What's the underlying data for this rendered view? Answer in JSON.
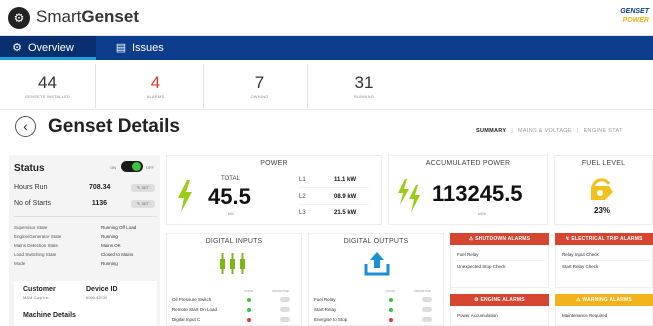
{
  "header": {
    "app_name_light": "Smart",
    "app_name_bold": "Genset",
    "brand_line1": "GENSET",
    "brand_line2": "POWER"
  },
  "nav": {
    "tabs": [
      {
        "label": "Overview",
        "icon": "gear-icon"
      },
      {
        "label": "Issues",
        "icon": "table-icon"
      }
    ]
  },
  "stats": [
    {
      "value": "44",
      "label": "GENSETS INSTALLED"
    },
    {
      "value": "4",
      "label": "ALARMS",
      "color": "#e03a2e"
    },
    {
      "value": "7",
      "label": "OWNING"
    },
    {
      "value": "31",
      "label": "RUNNING"
    }
  ],
  "page": {
    "title": "Genset Details",
    "back_icon": "back-arrow-icon",
    "sub_tabs": [
      "SUMMARY",
      "MAINS & VOLTAGE",
      "ENGINE STAT"
    ]
  },
  "status": {
    "title": "Status",
    "toggle_on": "ON",
    "toggle_off": "OFF",
    "hours_label": "Hours Run",
    "hours_value": "708.34",
    "starts_label": "No of Starts",
    "starts_value": "1136",
    "edit_label": "SET",
    "states": [
      {
        "label": "Supervisor State",
        "value": "Running Off Load"
      },
      {
        "label": "Engine/Generator State",
        "value": "Running"
      },
      {
        "label": "Mains Detection State",
        "value": "Mains OK"
      },
      {
        "label": "Load Switching State",
        "value": "Closed to Mains"
      },
      {
        "label": "Mode",
        "value": "Running"
      }
    ],
    "customer_label": "Customer",
    "customer_value": "M&M Corp Inc.",
    "device_label": "Device ID",
    "device_value": "6099-4DCB",
    "machine_label": "Machine Details"
  },
  "power": {
    "title": "POWER",
    "total_label": "TOTAL",
    "total_value": "45.5",
    "unit": "kW",
    "phases": [
      {
        "label": "L1",
        "value": "11.1 kW"
      },
      {
        "label": "L2",
        "value": "08.9 kW"
      },
      {
        "label": "L3",
        "value": "21.5 kW"
      }
    ]
  },
  "accumulated": {
    "title": "ACCUMULATED POWER",
    "value": "113245.5",
    "unit": "kWh"
  },
  "fuel": {
    "title": "FUEL LEVEL",
    "value": "23%"
  },
  "digital_inputs": {
    "title": "DIGITAL INPUTS",
    "col1": "STATE",
    "col2": "PRIORITISE",
    "rows": [
      {
        "label": "Oil Pressure Switch",
        "dot": "#3ec23e"
      },
      {
        "label": "Remote Start On Load",
        "dot": "#3ec23e"
      },
      {
        "label": "Digital Input C",
        "dot": "#e03a2e"
      }
    ]
  },
  "digital_outputs": {
    "title": "DIGITAL OUTPUTS",
    "col1": "STATE",
    "col2": "PRIORITISE",
    "rows": [
      {
        "label": "Fuel Relay",
        "dot": "#3ec23e"
      },
      {
        "label": "Start Relay",
        "dot": "#3ec23e"
      },
      {
        "label": "Energise to Stop",
        "dot": "#e03a2e"
      }
    ]
  },
  "alarms": {
    "shutdown": {
      "title": "SHUTDOWN ALARMS",
      "color": "#d6452f",
      "items": [
        "Fuel Relay",
        "Unexpected Stop Check"
      ]
    },
    "electrical": {
      "title": "ELECTRICAL TRIP ALARMS",
      "color": "#d6452f",
      "items": [
        "Relay Input Check",
        "Start Relay Check"
      ]
    },
    "engine": {
      "title": "ENGINE ALARMS",
      "color": "#d6452f",
      "items": [
        "Power Accumulation"
      ]
    },
    "warning": {
      "title": "WARNING ALARMS",
      "color": "#f2b21c",
      "items": [
        "Maintenance Required"
      ]
    }
  },
  "colors": {
    "nav": "#0b3d8c",
    "accent_green": "#9acd1a",
    "alarm_red": "#d6452f",
    "warning_yellow": "#f2b21c"
  }
}
